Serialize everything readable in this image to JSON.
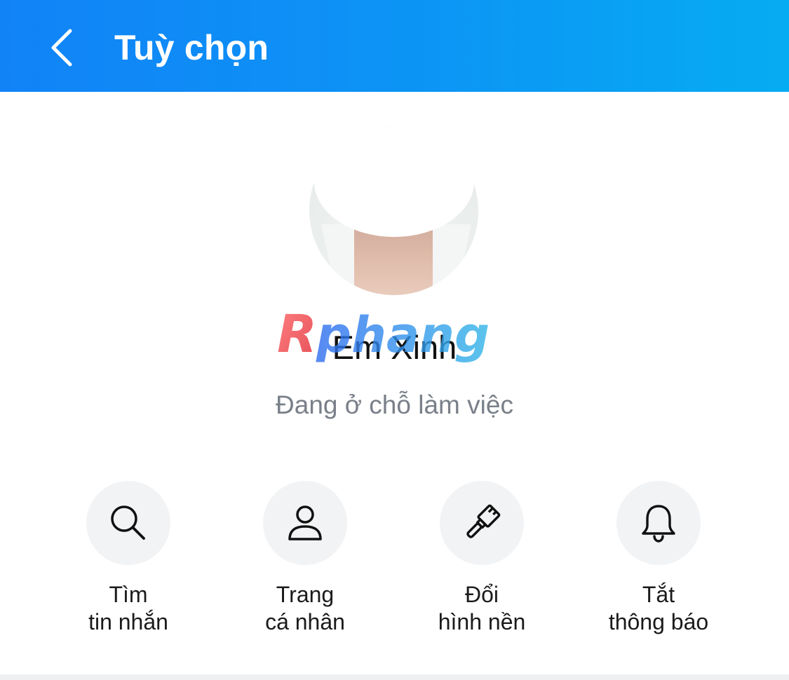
{
  "header": {
    "title": "Tuỳ chọn",
    "back_icon": "chevron-left-icon",
    "gradient_colors": [
      "#1183f7",
      "#06acf2"
    ]
  },
  "profile": {
    "name": "Em Xinh",
    "status": "Đang ở chỗ làm việc",
    "watermark_text": "Rphang"
  },
  "actions": [
    {
      "icon": "search-icon",
      "line1": "Tìm",
      "line2": "tin nhắn"
    },
    {
      "icon": "user-icon",
      "line1": "Trang",
      "line2": "cá nhân"
    },
    {
      "icon": "paintbrush-icon",
      "line1": "Đổi",
      "line2": "hình nền"
    },
    {
      "icon": "bell-icon",
      "line1": "Tắt",
      "line2": "thông báo"
    }
  ],
  "colors": {
    "header_text": "#ffffff",
    "status_text": "#7a8089",
    "icon_circle_bg": "#f2f3f5"
  }
}
